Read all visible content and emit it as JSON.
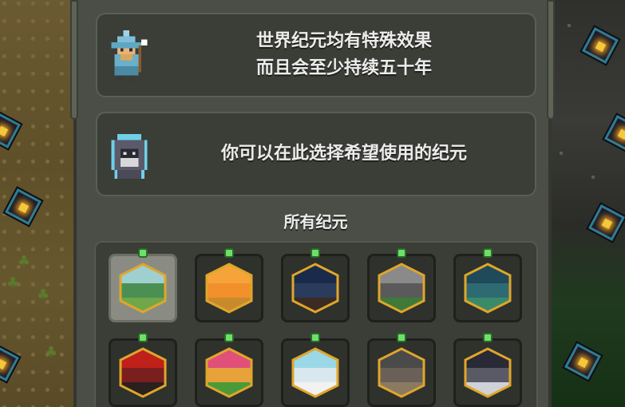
{
  "dialog": {
    "line1": "世界纪元均有特殊效果",
    "line2": "而且会至少持续五十年",
    "line3": "你可以在此选择希望使用的纪元"
  },
  "section_title": "所有纪元",
  "eras": [
    {
      "id": "era-1",
      "icon": "temperate-era-icon",
      "top": "#9fd0d0",
      "mid": "#4c8f52",
      "bottom": "#6fa84a",
      "selected": true
    },
    {
      "id": "era-2",
      "icon": "sun-desert-era-icon",
      "top": "#f6a43a",
      "mid": "#f2902c",
      "bottom": "#c98a2c",
      "selected": false
    },
    {
      "id": "era-3",
      "icon": "moon-night-era-icon",
      "top": "#1a2a4a",
      "mid": "#2a3b5b",
      "bottom": "#3b2b22",
      "selected": false
    },
    {
      "id": "era-4",
      "icon": "rain-era-icon",
      "top": "#8a8a8a",
      "mid": "#5a5a5a",
      "bottom": "#3f7a3a",
      "selected": false
    },
    {
      "id": "era-5",
      "icon": "moon-glow-era-icon",
      "top": "#1f4a5a",
      "mid": "#2e6a72",
      "bottom": "#3a8a6a",
      "selected": false
    },
    {
      "id": "era-6",
      "icon": "chaos-red-era-icon",
      "top": "#c0201a",
      "mid": "#7a1e1e",
      "bottom": "#2b2020",
      "selected": false
    },
    {
      "id": "era-7",
      "icon": "bloom-era-icon",
      "top": "#e0507a",
      "mid": "#e8a23c",
      "bottom": "#4a9a3a",
      "selected": false
    },
    {
      "id": "era-8",
      "icon": "snow-era-icon",
      "top": "#9ad8e8",
      "mid": "#d8e8ee",
      "bottom": "#f2f2f2",
      "selected": false
    },
    {
      "id": "era-9",
      "icon": "ash-era-icon",
      "top": "#4a4a4a",
      "mid": "#6a6058",
      "bottom": "#8a7a62",
      "selected": false
    },
    {
      "id": "era-10",
      "icon": "winter-night-era-icon",
      "top": "#2a2a36",
      "mid": "#5a5a66",
      "bottom": "#cfd2d8",
      "selected": false
    }
  ]
}
